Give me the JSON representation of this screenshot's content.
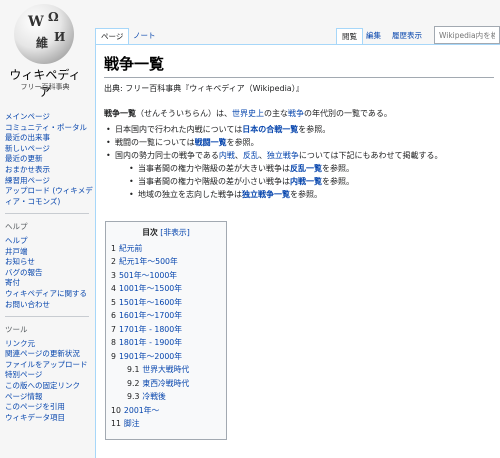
{
  "logo": {
    "title": "ウィキペディア",
    "subtitle": "フリー百科事典",
    "globe_glyphs": [
      "W",
      "Ω",
      "維",
      "И"
    ]
  },
  "sidebar": {
    "main": [
      "メインページ",
      "コミュニティ・ポータル",
      "最近の出来事",
      "新しいページ",
      "最近の更新",
      "おまかせ表示",
      "練習用ページ",
      "アップロード (ウィキメディア・コモンズ)"
    ],
    "help_heading": "ヘルプ",
    "help": [
      "ヘルプ",
      "井戸端",
      "お知らせ",
      "バグの報告",
      "寄付",
      "ウィキペディアに関するお問い合わせ"
    ],
    "tools_heading": "ツール",
    "tools": [
      "リンク元",
      "関連ページの更新状況",
      "ファイルをアップロード",
      "特別ページ",
      "この版への固定リンク",
      "ページ情報",
      "このページを引用",
      "ウィキデータ項目"
    ]
  },
  "tabs": {
    "page": "ページ",
    "talk": "ノート",
    "read": "閲覧",
    "edit": "編集",
    "history": "履歴表示"
  },
  "search": {
    "placeholder": "Wikipedia内を検索"
  },
  "article": {
    "title": "戦争一覧",
    "from_line": "出典: フリー百科事典『ウィキペディア（Wikipedia）』",
    "intro": {
      "term": "戦争一覧",
      "reading": "（せんそういちらん）は、",
      "link1": "世界史上",
      "mid1": "の主な",
      "link2": "戦争",
      "end": "の年代別の一覧である。"
    },
    "bullets": {
      "b1_pre": "日本国内で行われた内戦については",
      "b1_link": "日本の合戦一覧",
      "b1_post": "を参照。",
      "b2_pre": "戦闘の一覧については",
      "b2_link": "戦闘一覧",
      "b2_post": "を参照。",
      "b3_pre": "国内の勢力同士の戦争である",
      "b3_l1": "内戦",
      "b3_s1": "、",
      "b3_l2": "反乱",
      "b3_s2": "、",
      "b3_l3": "独立戦争",
      "b3_post": "については下記にもあわせて掲載する。",
      "s1_pre": "当事者間の権力や階級の差が大きい戦争は",
      "s1_link": "反乱一覧",
      "s1_post": "を参照。",
      "s2_pre": "当事者間の権力や階級の差が小さい戦争は",
      "s2_link": "内戦一覧",
      "s2_post": "を参照。",
      "s3_pre": "地域の独立を志向した戦争は",
      "s3_link": "独立戦争一覧",
      "s3_post": "を参照。"
    }
  },
  "toc": {
    "title": "目次",
    "toggle": "[非表示]",
    "items": [
      {
        "num": "1",
        "label": "紀元前"
      },
      {
        "num": "2",
        "label": "紀元1年〜500年"
      },
      {
        "num": "3",
        "label": "501年〜1000年"
      },
      {
        "num": "4",
        "label": "1001年〜1500年"
      },
      {
        "num": "5",
        "label": "1501年〜1600年"
      },
      {
        "num": "6",
        "label": "1601年〜1700年"
      },
      {
        "num": "7",
        "label": "1701年 - 1800年"
      },
      {
        "num": "8",
        "label": "1801年 - 1900年"
      },
      {
        "num": "9",
        "label": "1901年〜2000年"
      },
      {
        "num": "9.1",
        "label": "世界大戦時代"
      },
      {
        "num": "9.2",
        "label": "東西冷戦時代"
      },
      {
        "num": "9.3",
        "label": "冷戦後"
      },
      {
        "num": "10",
        "label": "2001年〜"
      },
      {
        "num": "11",
        "label": "脚注"
      }
    ]
  }
}
